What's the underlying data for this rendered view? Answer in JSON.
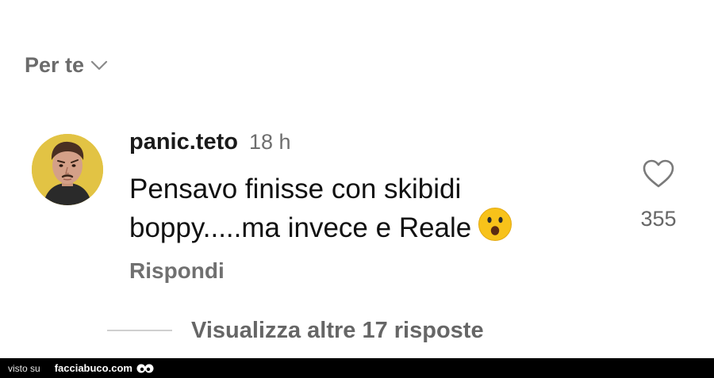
{
  "filter": {
    "label": "Per te",
    "icon": "chevron-down-icon"
  },
  "comment": {
    "username": "panic.teto",
    "time": "18 h",
    "text": "Pensavo finisse con skibidi boppy.....ma invece e Reale",
    "emoji": "astonished-face-icon",
    "reply_label": "Rispondi",
    "like_count": "355"
  },
  "thread": {
    "view_more_label": "Visualizza altre 17 risposte"
  },
  "watermark": {
    "prefix": "visto su",
    "brand": "facciabuco.com"
  },
  "colors": {
    "muted_text": "#6b6b6b",
    "avatar_bg": "#e9c93a",
    "divider": "#cfcfcf",
    "watermark_bg": "#000000"
  }
}
